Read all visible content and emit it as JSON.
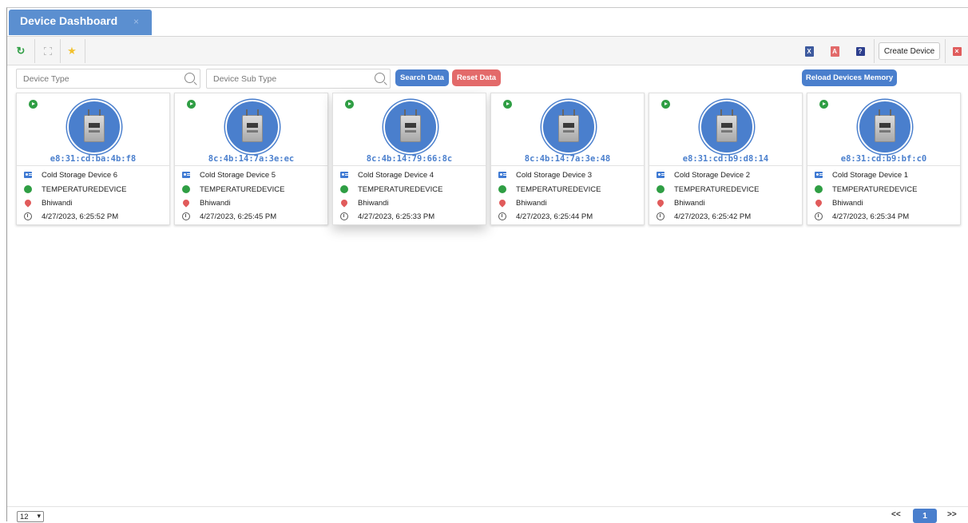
{
  "tab": {
    "title": "Device Dashboard",
    "close": "×"
  },
  "toolbar": {
    "refresh_icon": "refresh-icon",
    "fullscreen_icon": "fullscreen-icon",
    "favorite_icon": "star-icon",
    "excel_label": "X",
    "pdf_label": "A",
    "help_label": "?",
    "create_label": "Create Device",
    "close_label": "×"
  },
  "filters": {
    "device_type_placeholder": "Device Type",
    "device_sub_type_placeholder": "Device Sub Type",
    "search_label": "Search Data",
    "reset_label": "Reset Data",
    "reload_label": "Reload Devices Memory"
  },
  "colors": {
    "accent": "#4a7fcd",
    "danger": "#e36a6a",
    "success": "#2f9e44"
  },
  "devices": [
    {
      "mac": "e8:31:cd:ba:4b:f8",
      "name": "Cold Storage Device 6",
      "type": "TEMPERATUREDEVICE",
      "location": "Bhiwandi",
      "time": "4/27/2023, 6:25:52 PM"
    },
    {
      "mac": "8c:4b:14:7a:3e:ec",
      "name": "Cold Storage Device 5",
      "type": "TEMPERATUREDEVICE",
      "location": "Bhiwandi",
      "time": "4/27/2023, 6:25:45 PM"
    },
    {
      "mac": "8c:4b:14:79:66:8c",
      "name": "Cold Storage Device 4",
      "type": "TEMPERATUREDEVICE",
      "location": "Bhiwandi",
      "time": "4/27/2023, 6:25:33 PM"
    },
    {
      "mac": "8c:4b:14:7a:3e:48",
      "name": "Cold Storage Device 3",
      "type": "TEMPERATUREDEVICE",
      "location": "Bhiwandi",
      "time": "4/27/2023, 6:25:44 PM"
    },
    {
      "mac": "e8:31:cd:b9:d8:14",
      "name": "Cold Storage Device 2",
      "type": "TEMPERATUREDEVICE",
      "location": "Bhiwandi",
      "time": "4/27/2023, 6:25:42 PM"
    },
    {
      "mac": "e8:31:cd:b9:bf:c0",
      "name": "Cold Storage Device 1",
      "type": "TEMPERATUREDEVICE",
      "location": "Bhiwandi",
      "time": "4/27/2023, 6:25:34 PM"
    }
  ],
  "pagination": {
    "page_size": "12",
    "prev": "<<",
    "current": "1",
    "next": ">>"
  }
}
